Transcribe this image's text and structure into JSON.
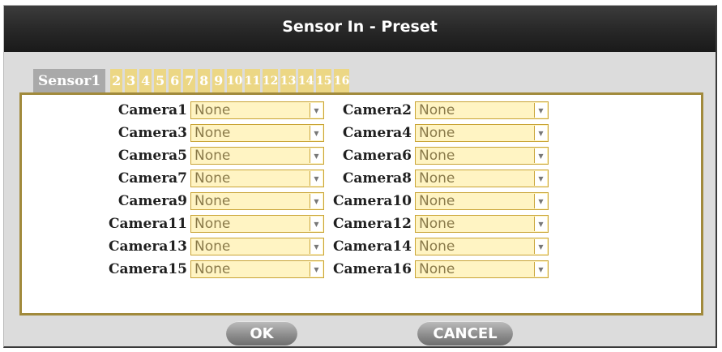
{
  "dialog": {
    "title": "Sensor In - Preset"
  },
  "tabs": [
    "Sensor1",
    "2",
    "3",
    "4",
    "5",
    "6",
    "7",
    "8",
    "9",
    "10",
    "11",
    "12",
    "13",
    "14",
    "15",
    "16"
  ],
  "cameras": [
    {
      "label": "Camera1",
      "value": "None"
    },
    {
      "label": "Camera2",
      "value": "None"
    },
    {
      "label": "Camera3",
      "value": "None"
    },
    {
      "label": "Camera4",
      "value": "None"
    },
    {
      "label": "Camera5",
      "value": "None"
    },
    {
      "label": "Camera6",
      "value": "None"
    },
    {
      "label": "Camera7",
      "value": "None"
    },
    {
      "label": "Camera8",
      "value": "None"
    },
    {
      "label": "Camera9",
      "value": "None"
    },
    {
      "label": "Camera10",
      "value": "None"
    },
    {
      "label": "Camera11",
      "value": "None"
    },
    {
      "label": "Camera12",
      "value": "None"
    },
    {
      "label": "Camera13",
      "value": "None"
    },
    {
      "label": "Camera14",
      "value": "None"
    },
    {
      "label": "Camera15",
      "value": "None"
    },
    {
      "label": "Camera16",
      "value": "None"
    }
  ],
  "buttons": {
    "ok": "OK",
    "cancel": "CANCEL"
  },
  "colors": {
    "tab_inactive": "#ecd785",
    "tab_active": "#a9a9a9",
    "panel_border": "#a18a3c",
    "select_bg": "#fff4c3"
  },
  "icons": {
    "dropdown": "chevron-down-icon"
  }
}
